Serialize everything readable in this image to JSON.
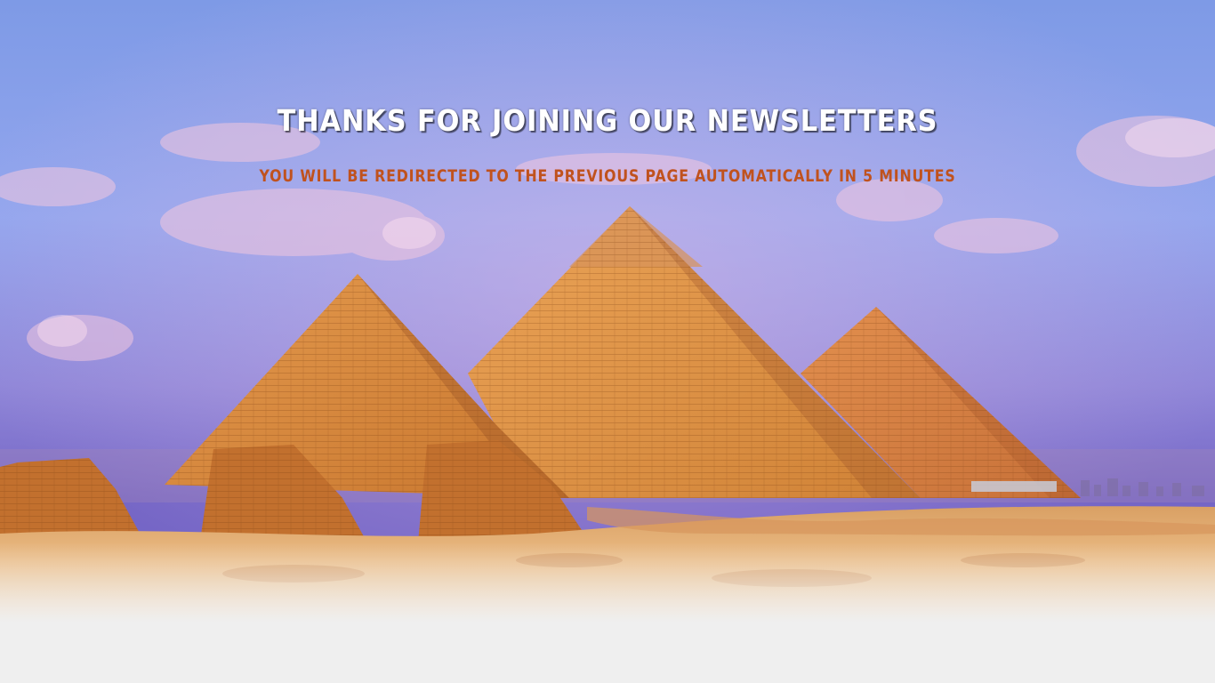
{
  "headline": "THANKS FOR JOINING OUR NEWSLETTERS",
  "subheadline": "YOU WILL BE REDIRECTED TO THE PREVIOUS PAGE AUTOMATICALLY IN 5 MINUTES",
  "colors": {
    "headline_text": "#ffffff",
    "subheadline_text": "#c0521e",
    "page_background": "#efefef",
    "sky_top": "#7f9be6",
    "sand": "#e8b47a"
  },
  "image": {
    "subject": "pyramids-of-giza"
  }
}
